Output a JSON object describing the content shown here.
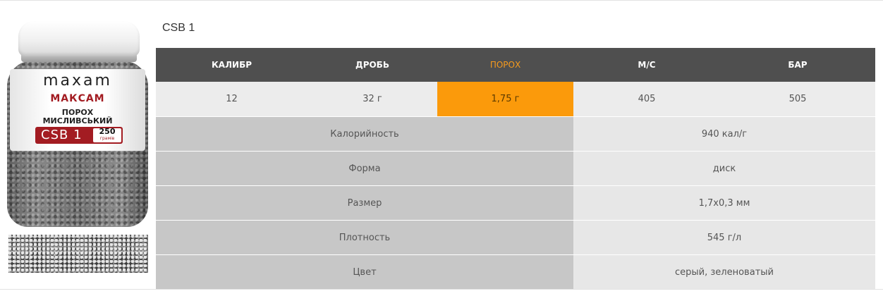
{
  "title": "CSB 1",
  "product_label": {
    "logo": "maxam",
    "brand_ua": "МАКСАМ",
    "desc_line1": "ПОРОХ",
    "desc_line2": "МИСЛИВСЬКИЙ",
    "code": "CSB 1",
    "weight": "250",
    "unit": "грамів"
  },
  "table": {
    "headers": [
      "КАЛИБР",
      "ДРОБЬ",
      "ПОРОХ",
      "М/С",
      "БАР"
    ],
    "values": [
      "12",
      "32 г",
      "1,75 г",
      "405",
      "505"
    ],
    "highlight_column": 2,
    "properties": [
      {
        "name": "Калорийность",
        "value": "940 кал/г"
      },
      {
        "name": "Форма",
        "value": "диск"
      },
      {
        "name": "Размер",
        "value": "1,7х0,3 мм"
      },
      {
        "name": "Плотность",
        "value": "545 г/л"
      },
      {
        "name": "Цвет",
        "value": "серый, зеленоватый"
      }
    ]
  },
  "colors": {
    "header_bg": "#4f4f4f",
    "accent": "#fb9a0b",
    "brand_red": "#a31c22"
  }
}
